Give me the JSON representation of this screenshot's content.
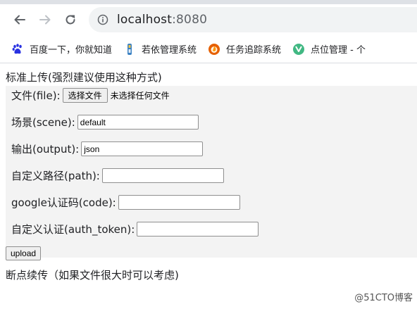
{
  "browser": {
    "url_host": "localhost",
    "url_port": ":8080",
    "bookmarks": [
      {
        "label": "百度一下，你就知道",
        "icon": "baidu-paw-icon"
      },
      {
        "label": "若依管理系统",
        "icon": "ruoyi-icon"
      },
      {
        "label": "任务追踪系统",
        "icon": "firefox-like-icon"
      },
      {
        "label": "点位管理 - 个",
        "icon": "vue-icon"
      }
    ]
  },
  "page": {
    "section1_title": "标准上传(强烈建议使用这种方式)",
    "file_label": "文件(file):",
    "file_button": "选择文件",
    "file_hint": "未选择任何文件",
    "scene_label": "场景(scene):",
    "scene_value": "default",
    "output_label": "输出(output):",
    "output_value": "json",
    "path_label": "自定义路径(path):",
    "path_value": "",
    "code_label": "google认证码(code):",
    "code_value": "",
    "token_label": "自定义认证(auth_token):",
    "token_value": "",
    "upload_button": "upload",
    "section2_title": "断点续传（如果文件很大时可以考虑)"
  },
  "watermark": "@51CTO博客",
  "colors": {
    "form_bg": "#f3f3f3",
    "omnibox_bg": "#f1f3f4"
  }
}
